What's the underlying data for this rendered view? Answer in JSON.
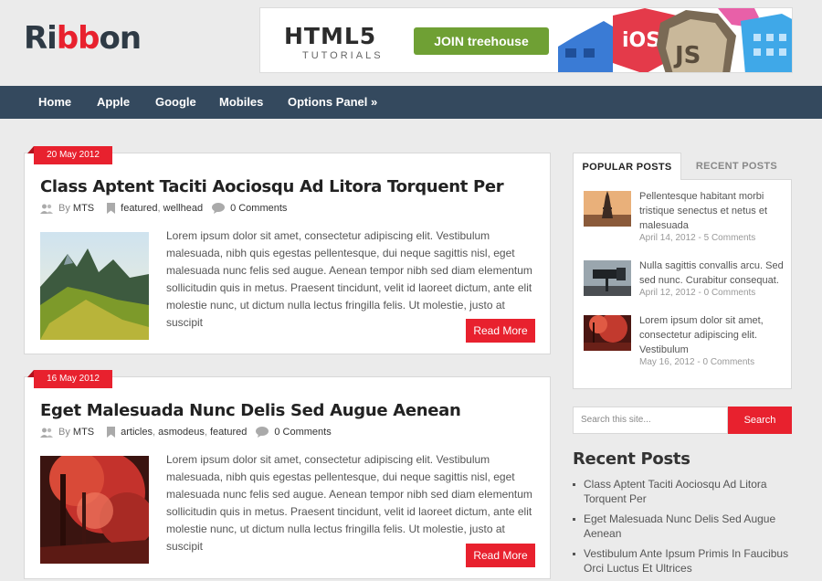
{
  "header": {
    "logo_part1": "Ri",
    "logo_part2": "bb",
    "logo_part3": "on",
    "ad": {
      "headline": "HTML5",
      "subline": "TUTORIALS",
      "button_part1": "JOIN ",
      "button_part2": "treehouse"
    }
  },
  "nav": {
    "items": [
      "Home",
      "Apple",
      "Google",
      "Mobiles",
      "Options Panel »"
    ]
  },
  "posts": [
    {
      "date": "20 May 2012",
      "title": "Class Aptent Taciti Aociosqu Ad Litora Torquent Per",
      "by": "By",
      "author": "MTS",
      "tag1": "featured",
      "sep": ",",
      "tag2": "wellhead",
      "comments": "0 Comments",
      "excerpt": "Lorem ipsum dolor sit amet, consectetur adipiscing elit. Vestibulum malesuada, nibh quis egestas pellentesque, dui neque sagittis nisl, eget malesuada nunc felis sed augue. Aenean tempor nibh sed diam elementum sollicitudin quis in metus. Praesent tincidunt, velit id laoreet dictum, ante elit molestie nunc, ut dictum nulla lectus fringilla felis. Ut molestie, justo at suscipit",
      "read_more": "Read More"
    },
    {
      "date": "16 May 2012",
      "title": "Eget Malesuada Nunc Delis Sed Augue Aenean",
      "by": "By",
      "author": "MTS",
      "tag1": "articles",
      "sep": ",",
      "tag2": "asmodeus",
      "tag3": "featured",
      "comments": "0 Comments",
      "excerpt": "Lorem ipsum dolor sit amet, consectetur adipiscing elit. Vestibulum malesuada, nibh quis egestas pellentesque, dui neque sagittis nisl, eget malesuada nunc felis sed augue. Aenean tempor nibh sed diam elementum sollicitudin quis in metus. Praesent tincidunt, velit id laoreet dictum, ante elit molestie nunc, ut dictum nulla lectus fringilla felis. Ut molestie, justo at suscipit",
      "read_more": "Read More"
    }
  ],
  "sidebar": {
    "tabs": {
      "active": "POPULAR POSTS",
      "inactive": "RECENT POSTS"
    },
    "popular": [
      {
        "title": "Pellentesque habitant morbi tristique senectus et netus et malesuada",
        "date": "April 14, 2012",
        "sep": " - ",
        "comments": "5 Comments"
      },
      {
        "title": "Nulla sagittis convallis arcu. Sed sed nunc. Curabitur consequat.",
        "date": "April 12, 2012",
        "sep": " - ",
        "comments": "0 Comments"
      },
      {
        "title": "Lorem ipsum dolor sit amet, consectetur adipiscing elit. Vestibulum",
        "date": "May 16, 2012",
        "sep": " - ",
        "comments": "0 Comments"
      }
    ],
    "search": {
      "placeholder": "Search this site...",
      "button": "Search"
    },
    "recent": {
      "heading": "Recent Posts",
      "items": [
        "Class Aptent Taciti Aociosqu Ad Litora Torquent Per",
        "Eget Malesuada Nunc Delis Sed Augue Aenean",
        "Vestibulum Ante Ipsum Primis In Faucibus Orci Luctus Et Ultrices"
      ]
    }
  },
  "colors": {
    "accent": "#e8212e",
    "nav_bg": "#34495e",
    "logo_dark": "#2e3a45"
  }
}
